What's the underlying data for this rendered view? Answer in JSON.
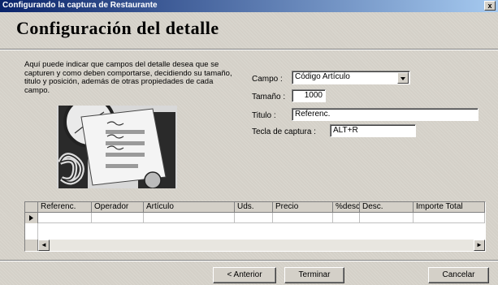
{
  "window": {
    "title": "Configurando la captura de Restaurante",
    "close_label": "x"
  },
  "heading": "Configuración del detalle",
  "description": "Aquí puede indicar que campos del detalle desea que se capturen y como deben comportarse, decidiendo su tamaño, titulo y posición, además de otras propiedades de cada campo.",
  "form": {
    "campo_label": "Campo :",
    "campo_value": "Código Artículo",
    "tamano_label": "Tamaño :",
    "tamano_value": "1000",
    "titulo_label": "Titulo :",
    "titulo_value": "Referenc.",
    "tecla_label": "Tecla de captura :",
    "tecla_value": "ALT+R"
  },
  "grid": {
    "columns": [
      "Referenc.",
      "Operador",
      "Artículo",
      "Uds.",
      "Precio",
      "%desc",
      "Desc.",
      "Importe Total"
    ],
    "scroll_left": "◄",
    "scroll_right": "►"
  },
  "buttons": {
    "anterior": "< Anterior",
    "terminar": "Terminar",
    "cancelar": "Cancelar"
  }
}
